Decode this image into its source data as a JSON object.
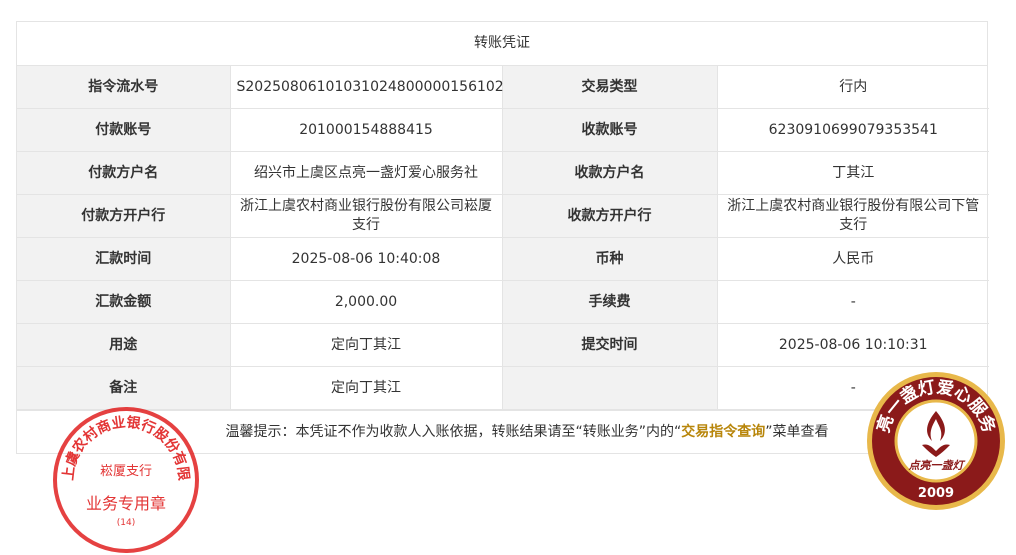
{
  "title": "转账凭证",
  "rows": [
    {
      "l1": "指令流水号",
      "v1": "S20250806101031024800000156102",
      "l2": "交易类型",
      "v2": "行内"
    },
    {
      "l1": "付款账号",
      "v1": "201000154888415",
      "l2": "收款账号",
      "v2": "6230910699079353541"
    },
    {
      "l1": "付款方户名",
      "v1": "绍兴市上虞区点亮一盏灯爱心服务社",
      "l2": "收款方户名",
      "v2": "丁其江"
    },
    {
      "l1": "付款方开户行",
      "v1": "浙江上虞农村商业银行股份有限公司崧厦支行",
      "l2": "收款方开户行",
      "v2": "浙江上虞农村商业银行股份有限公司下管支行"
    },
    {
      "l1": "汇款时间",
      "v1": "2025-08-06 10:40:08",
      "l2": "币种",
      "v2": "人民币"
    },
    {
      "l1": "汇款金额",
      "v1": "2,000.00",
      "l2": "手续费",
      "v2": "-"
    },
    {
      "l1": "用途",
      "v1": "定向丁其江",
      "l2": "提交时间",
      "v2": "2025-08-06 10:10:31"
    },
    {
      "l1": "备注",
      "v1": "定向丁其江",
      "l2": "",
      "v2": "-"
    }
  ],
  "tip": {
    "prefix": "温馨提示：本凭证不作为收款人入账依据，转账结果请至“转账业务”内的“",
    "link": "交易指令查询",
    "suffix": "”菜单查看"
  },
  "stamp_bank": {
    "ring": "浙江上虞农村商业银行股份有限公司",
    "branch": "崧厦支行",
    "purpose": "业务专用章",
    "code": "(14)",
    "color": "#e02020"
  },
  "stamp_logo": {
    "ring": "点亮一盏灯爱心服务社",
    "signature": "点亮一盏灯",
    "year": "2009",
    "color": "#8b1a1a",
    "gold": "#e8b84a"
  }
}
